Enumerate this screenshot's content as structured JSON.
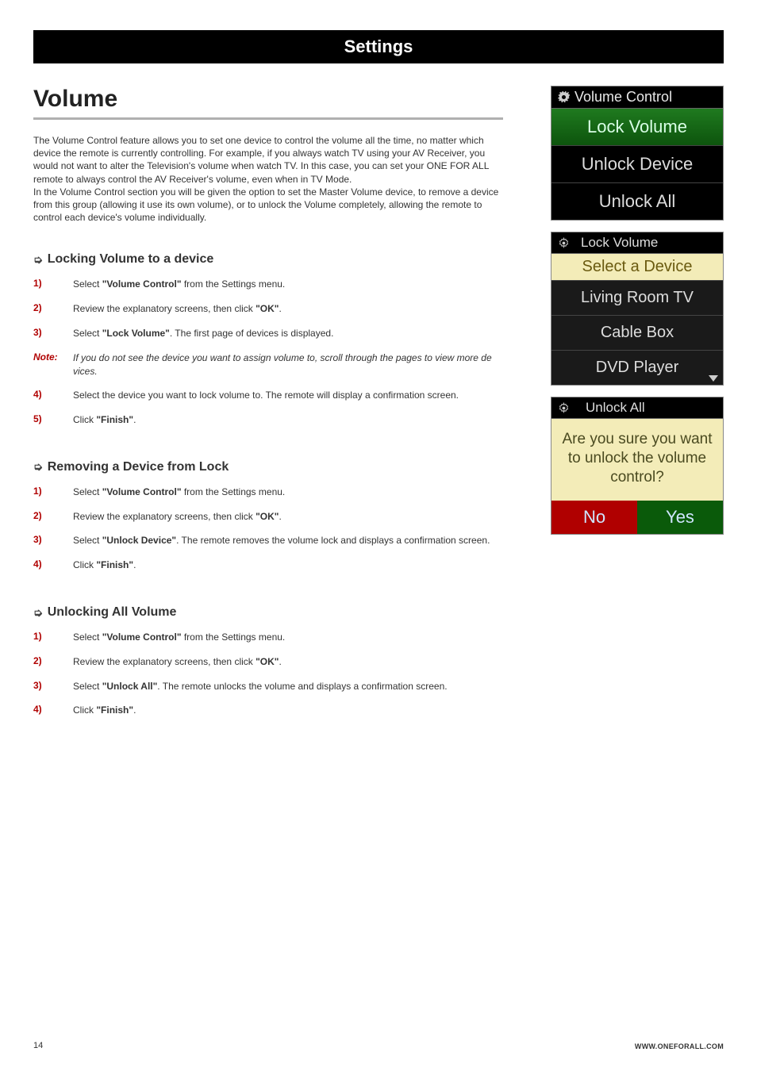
{
  "settings_bar": "Settings",
  "page_title": "Volume",
  "intro_text": "The Volume Control feature allows you to set one device to control the volume all the time, no matter which device the remote is currently controlling.  For example, if you always watch TV using your AV Receiver, you would not want to alter the Television's volume when watch TV. In this case, you can set your ONE FOR ALL remote to always control the AV Receiver's volume, even when in TV Mode.\nIn the Volume Control section you will be given the option to set the Master Volume device, to remove a device from this group (allowing it use its own volume), or to unlock the Volume completely, allowing the remote to control each device's volume individually.",
  "sections": {
    "lock": {
      "heading": "Locking Volume to a device",
      "steps": [
        {
          "num": "1)",
          "pre": "Select ",
          "b": "\"Volume Control\"",
          "post": " from the Settings menu."
        },
        {
          "num": "2)",
          "pre": "Review the explanatory screens, then click ",
          "b": "\"OK\"",
          "post": "."
        },
        {
          "num": "3)",
          "pre": "Select ",
          "b": "\"Lock Volume\"",
          "post": ". The first page of devices is displayed."
        },
        {
          "num": "Note:",
          "note": true,
          "text": "If you do not see the device you want to assign volume to, scroll through the pages to view more de vices."
        },
        {
          "num": "4)",
          "pre": "Select the device you want to lock volume to. The remote will display a confirmation screen.",
          "b": "",
          "post": ""
        },
        {
          "num": "5)",
          "pre": "Click ",
          "b": "\"Finish\"",
          "post": "."
        }
      ]
    },
    "remove": {
      "heading": "Removing a Device from Lock",
      "steps": [
        {
          "num": "1)",
          "pre": "Select ",
          "b": "\"Volume Control\"",
          "post": " from the Settings menu."
        },
        {
          "num": "2)",
          "pre": "Review the explanatory screens, then click ",
          "b": "\"OK\"",
          "post": "."
        },
        {
          "num": "3)",
          "pre": "Select ",
          "b": "\"Unlock Device\"",
          "post": ". The remote removes the volume lock and displays a confirmation screen."
        },
        {
          "num": "4)",
          "pre": "Click ",
          "b": "\"Finish\"",
          "post": "."
        }
      ]
    },
    "unlock": {
      "heading": "Unlocking All Volume",
      "steps": [
        {
          "num": "1)",
          "pre": "Select ",
          "b": "\"Volume Control\"",
          "post": " from the Settings menu."
        },
        {
          "num": "2)",
          "pre": "Review the explanatory screens, then click ",
          "b": "\"OK\"",
          "post": "."
        },
        {
          "num": "3)",
          "pre": "Select ",
          "b": "\"Unlock All\"",
          "post": ". The remote unlocks the volume and displays a confirmation screen."
        },
        {
          "num": "4)",
          "pre": "Click ",
          "b": "\"Finish\"",
          "post": "."
        }
      ]
    }
  },
  "screen1": {
    "header": "Volume Control",
    "rows": [
      "Lock Volume",
      "Unlock Device",
      "Unlock All"
    ]
  },
  "screen2": {
    "header": "Lock Volume",
    "headline": "Select a Device",
    "devices": [
      "Living Room TV",
      "Cable Box",
      "DVD Player"
    ]
  },
  "screen3": {
    "header": "Unlock All",
    "message": "Are you sure you want to unlock the volume control?",
    "no": "No",
    "yes": "Yes"
  },
  "page_number": "14",
  "footer_url": "WWW.ONEFORALL.COM"
}
